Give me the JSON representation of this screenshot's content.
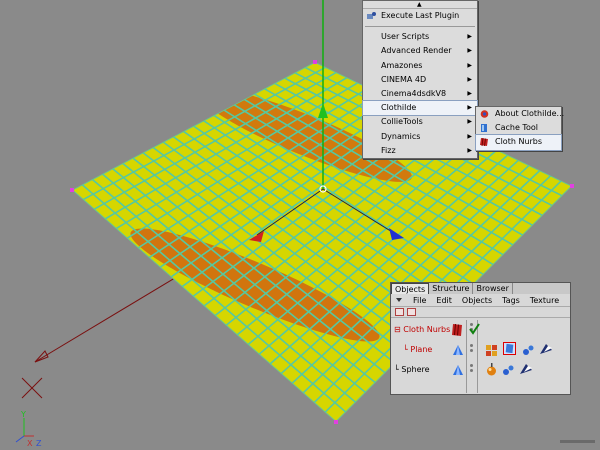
{
  "main_menu": {
    "items": [
      {
        "label": "Execute Last Plugin",
        "icon": "plugin-icon",
        "submenu": false
      },
      {
        "label": "User Scripts",
        "submenu": true
      },
      {
        "label": "Advanced Render",
        "submenu": true
      },
      {
        "label": "Amazones",
        "submenu": true
      },
      {
        "label": "CINEMA 4D",
        "submenu": true
      },
      {
        "label": "Cinema4dsdkV8",
        "submenu": true
      },
      {
        "label": "Clothilde",
        "submenu": true,
        "selected": true
      },
      {
        "label": "CollieTools",
        "submenu": true
      },
      {
        "label": "Dynamics",
        "submenu": true
      },
      {
        "label": "Fizz",
        "submenu": true
      }
    ],
    "arrow_glyph": "▶",
    "scroll_up_glyph": "▲"
  },
  "sub_menu": {
    "items": [
      {
        "label": "About Clothilde...",
        "icon": "about-icon"
      },
      {
        "label": "Cache Tool",
        "icon": "cache-tool-icon"
      },
      {
        "label": "Cloth Nurbs",
        "icon": "cloth-nurbs-icon",
        "selected": true
      }
    ]
  },
  "object_manager": {
    "tabs": [
      "Objects",
      "Structure",
      "Browser"
    ],
    "active_tab": "Objects",
    "menu": [
      "File",
      "Edit",
      "Objects",
      "Tags",
      "Texture"
    ],
    "tree": [
      {
        "label": "Cloth Nurbs",
        "prefix": "⊟",
        "highlight": true
      },
      {
        "label": "Plane",
        "prefix": "└",
        "highlight": true
      },
      {
        "label": "Sphere",
        "prefix": "└",
        "highlight": false
      }
    ]
  },
  "axis_labels": {
    "y": "Y",
    "x": "X",
    "z": "Z"
  },
  "colors": {
    "viewport_bg": "#8a8a8a",
    "tile_yellow": "#d6d600",
    "tile_orange": "#d06a10",
    "grid_lines": "#57c8a0",
    "selection_red": "#c00000"
  }
}
